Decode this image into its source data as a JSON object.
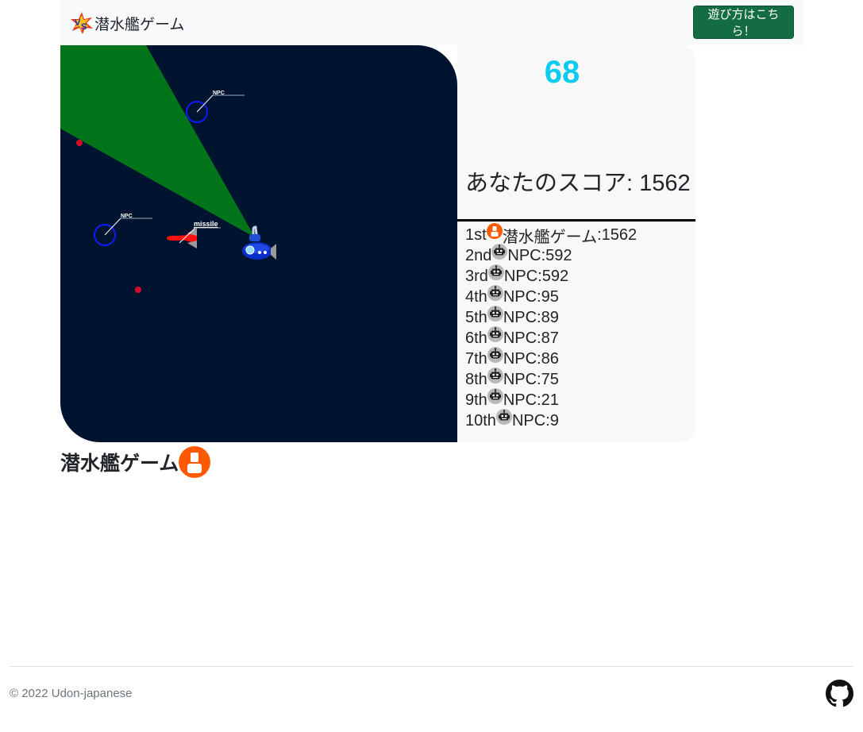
{
  "navbar": {
    "brand_text": "潜水艦ゲーム",
    "how_to_play_label": "遊び方はこちら！"
  },
  "game": {
    "npc_label": "NPC",
    "missile_label": "missile"
  },
  "panel": {
    "timer": "68",
    "score_text": "あなたのスコア: 1562",
    "ranking": [
      {
        "rank": "1st",
        "icon": "user-icon",
        "name": "潜水艦ゲーム",
        "score": "1562"
      },
      {
        "rank": "2nd",
        "icon": "robot-icon",
        "name": "NPC",
        "score": "592"
      },
      {
        "rank": "3rd",
        "icon": "robot-icon",
        "name": "NPC",
        "score": "592"
      },
      {
        "rank": "4th",
        "icon": "robot-icon",
        "name": "NPC",
        "score": "95"
      },
      {
        "rank": "5th",
        "icon": "robot-icon",
        "name": "NPC",
        "score": "89"
      },
      {
        "rank": "6th",
        "icon": "robot-icon",
        "name": "NPC",
        "score": "87"
      },
      {
        "rank": "7th",
        "icon": "robot-icon",
        "name": "NPC",
        "score": "86"
      },
      {
        "rank": "8th",
        "icon": "robot-icon",
        "name": "NPC",
        "score": "75"
      },
      {
        "rank": "9th",
        "icon": "robot-icon",
        "name": "NPC",
        "score": "21"
      },
      {
        "rank": "10th",
        "icon": "robot-icon",
        "name": "NPC",
        "score": "9"
      }
    ]
  },
  "player": {
    "name": "潜水艦ゲーム"
  },
  "footer": {
    "copyright": "© 2022 Udon-japanese"
  },
  "colors": {
    "ocean": "#001430",
    "sonar": "#02751a",
    "timer": "#0dcaf0",
    "button": "#146c43",
    "avatar": "#ff5a00"
  }
}
